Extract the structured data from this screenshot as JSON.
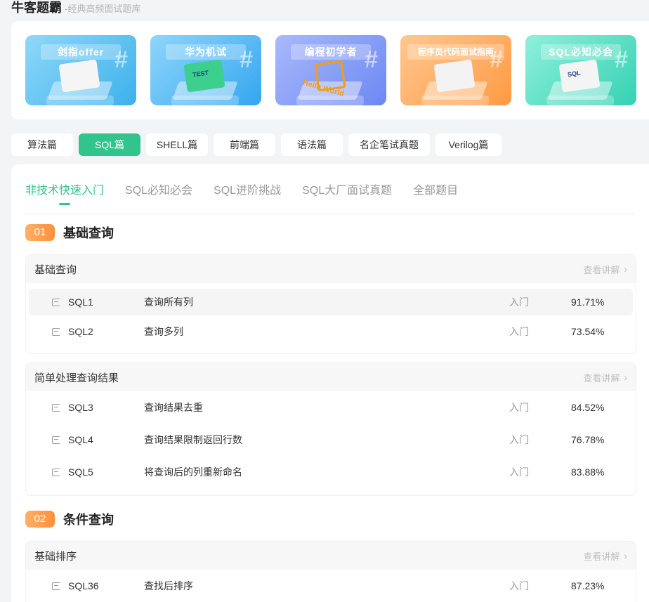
{
  "header": {
    "title": "牛客题霸",
    "subtitle": "-经典高频面试题库"
  },
  "banners": [
    {
      "label": "剑指offer",
      "book_text": ""
    },
    {
      "label": "华为机试",
      "book_text": "TEST"
    },
    {
      "label": "编程初学者",
      "book_text": "Hello World"
    },
    {
      "label": "程序员代码面试指南",
      "book_text": ""
    },
    {
      "label": "SQL必知必会",
      "book_text": "SQL"
    }
  ],
  "categories": [
    "算法篇",
    "SQL篇",
    "SHELL篇",
    "前端篇",
    "语法篇",
    "名企笔试真题",
    "Verilog篇"
  ],
  "active_category": "SQL篇",
  "sub_tabs": [
    "非技术快速入门",
    "SQL必知必会",
    "SQL进阶挑战",
    "SQL大厂面试真题",
    "全部题目"
  ],
  "active_sub_tab": "非技术快速入门",
  "link_label": "查看讲解",
  "chapters": [
    {
      "num": "01",
      "title": "基础查询"
    },
    {
      "num": "02",
      "title": "条件查询"
    }
  ],
  "sections": [
    {
      "name": "基础查询",
      "rows": [
        {
          "id": "SQL1",
          "title": "查询所有列",
          "level": "入门",
          "rate": "91.71%"
        },
        {
          "id": "SQL2",
          "title": "查询多列",
          "level": "入门",
          "rate": "73.54%"
        }
      ]
    },
    {
      "name": "简单处理查询结果",
      "rows": [
        {
          "id": "SQL3",
          "title": "查询结果去重",
          "level": "入门",
          "rate": "84.52%"
        },
        {
          "id": "SQL4",
          "title": "查询结果限制返回行数",
          "level": "入门",
          "rate": "76.78%"
        },
        {
          "id": "SQL5",
          "title": "将查询后的列重新命名",
          "level": "入门",
          "rate": "83.88%"
        }
      ]
    },
    {
      "name": "基础排序",
      "rows": [
        {
          "id": "SQL36",
          "title": "查找后排序",
          "level": "入门",
          "rate": "87.23%"
        }
      ]
    }
  ],
  "colors": {
    "accent": "#32c48d",
    "chapter": "#ff8f3a"
  }
}
